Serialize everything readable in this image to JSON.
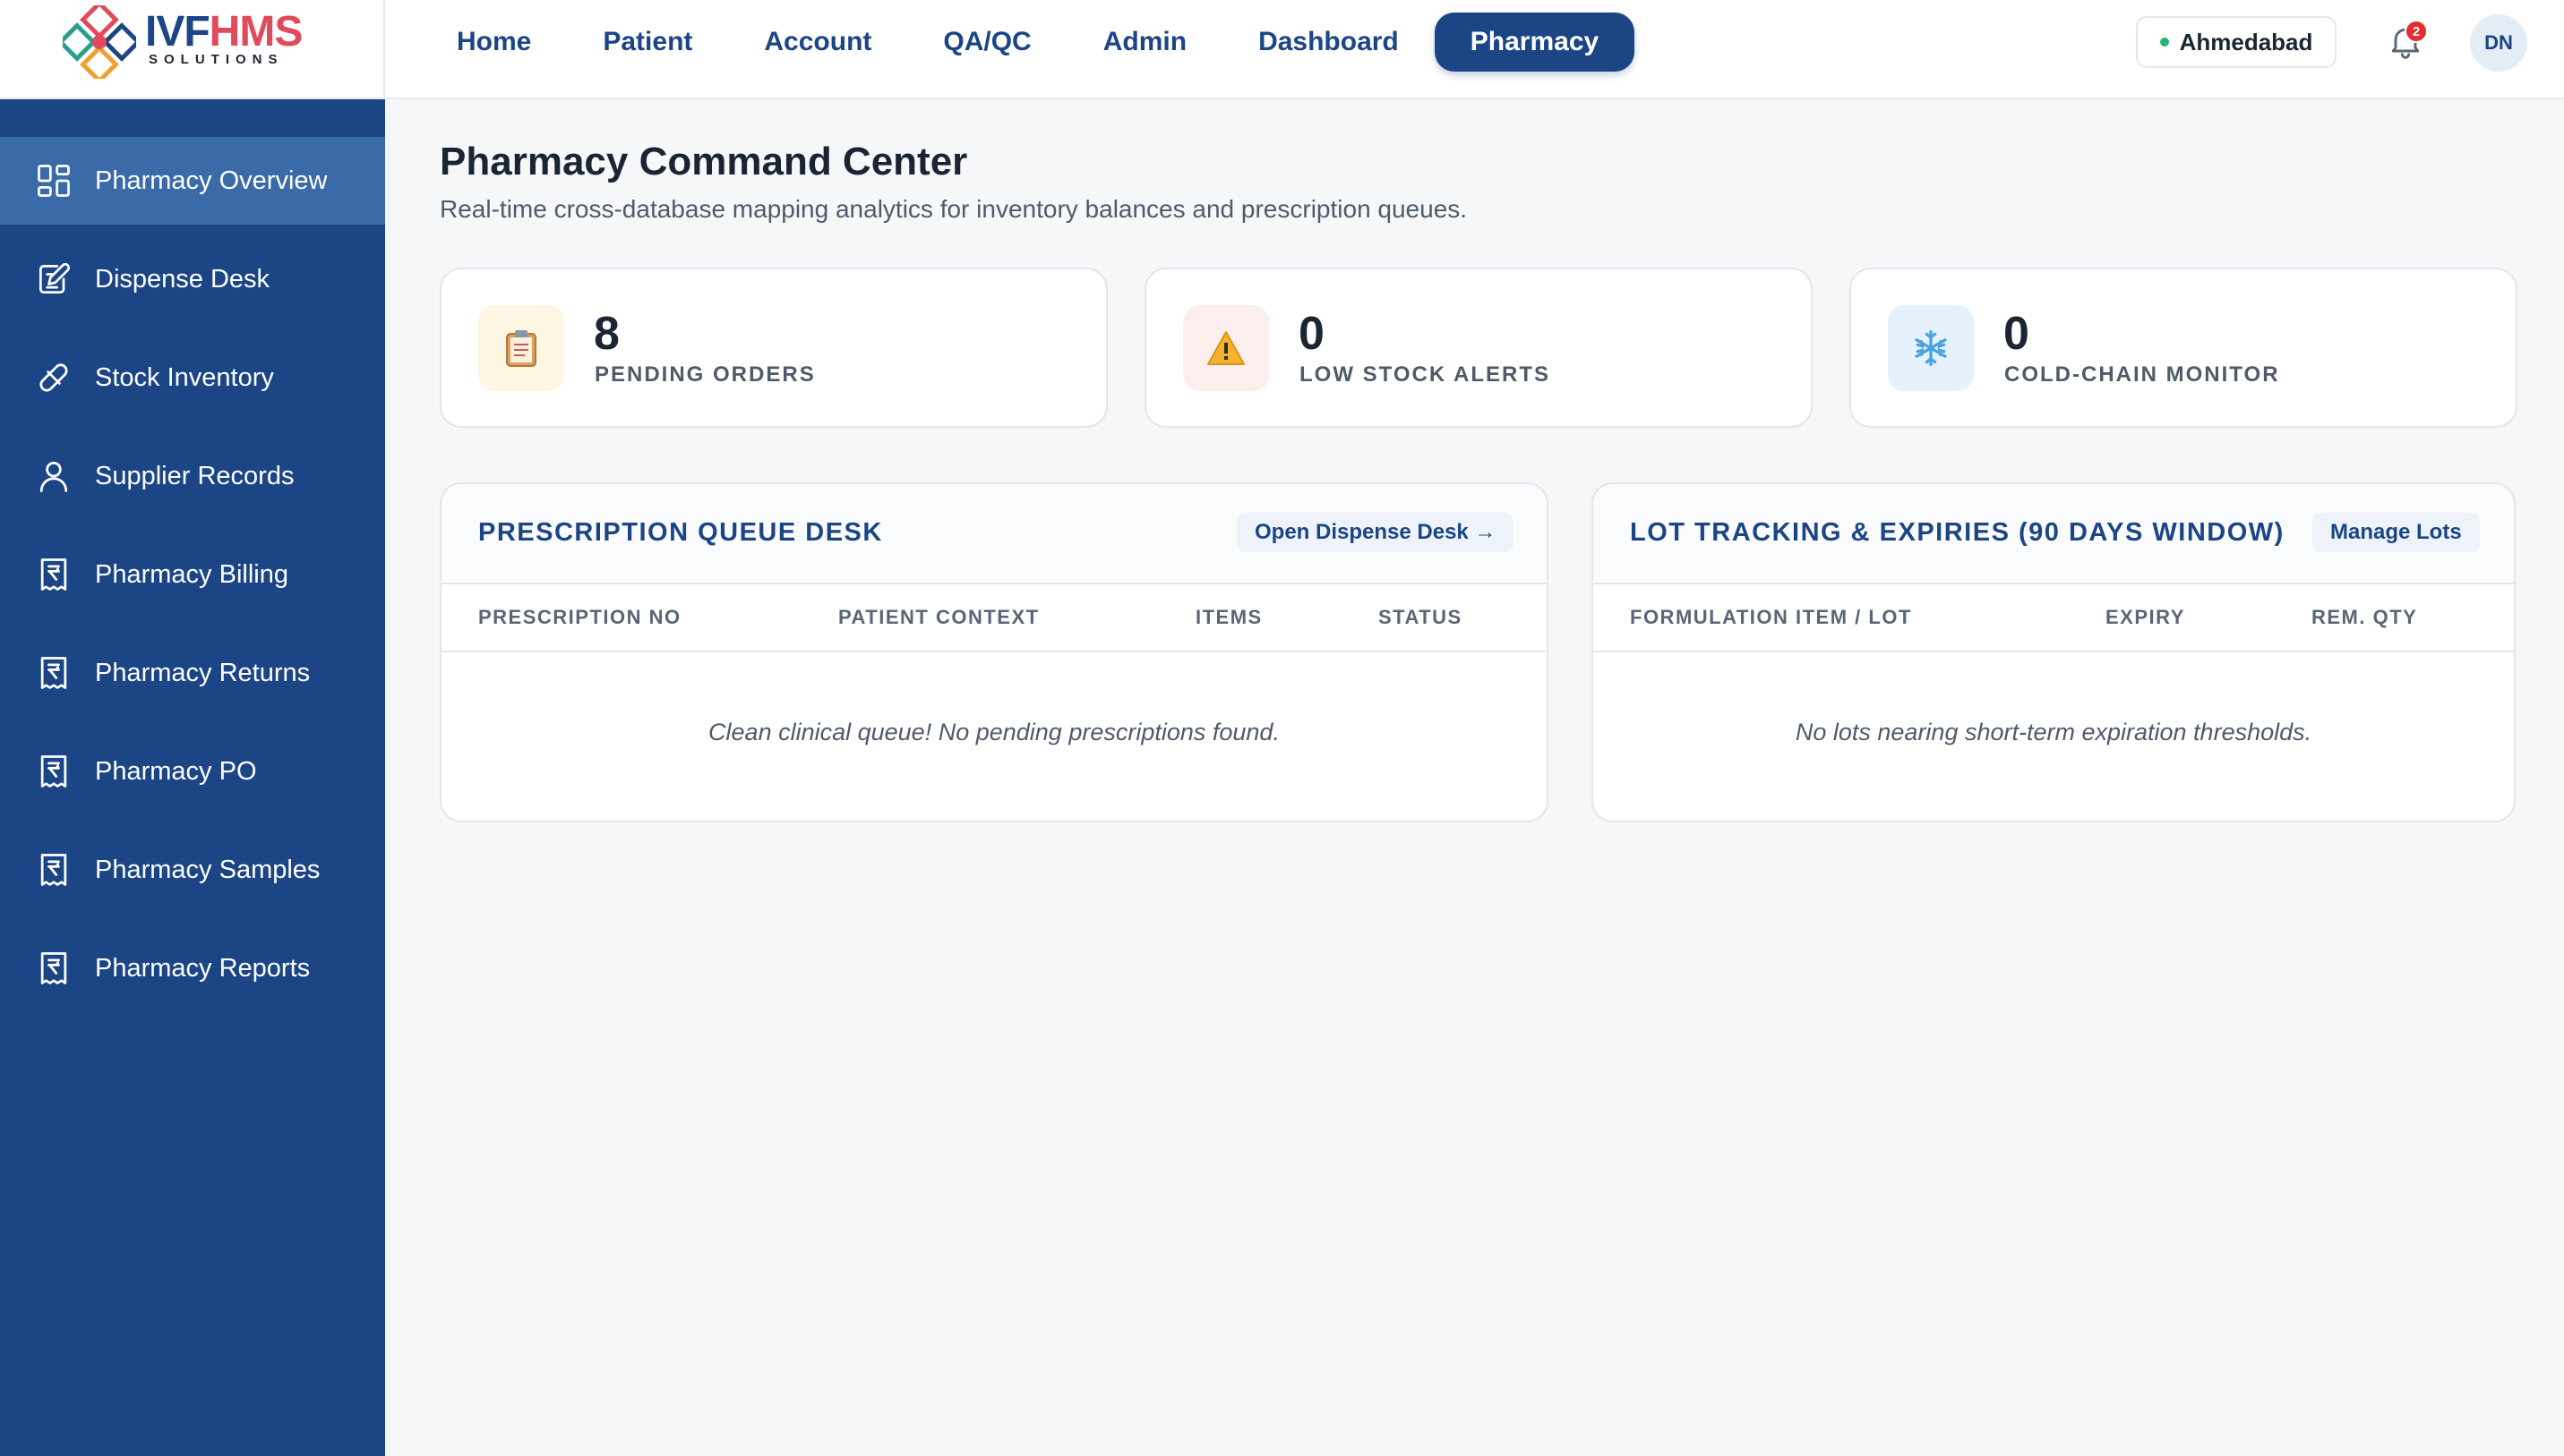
{
  "brand": {
    "name_part1": "IVF",
    "name_part2": "HMS",
    "subtitle": "SOLUTIONS"
  },
  "nav": {
    "items": [
      {
        "label": "Home"
      },
      {
        "label": "Patient"
      },
      {
        "label": "Account"
      },
      {
        "label": "QA/QC"
      },
      {
        "label": "Admin"
      },
      {
        "label": "Dashboard"
      },
      {
        "label": "Pharmacy",
        "active": true
      }
    ]
  },
  "header": {
    "branch": "Ahmedabad",
    "notification_count": "2",
    "avatar_initials": "DN"
  },
  "sidebar": {
    "items": [
      {
        "label": "Pharmacy Overview",
        "icon": "grid-icon",
        "active": true
      },
      {
        "label": "Dispense Desk",
        "icon": "edit-document-icon"
      },
      {
        "label": "Stock Inventory",
        "icon": "pill-icon"
      },
      {
        "label": "Supplier Records",
        "icon": "user-icon"
      },
      {
        "label": "Pharmacy Billing",
        "icon": "rupee-receipt-icon"
      },
      {
        "label": "Pharmacy Returns",
        "icon": "rupee-receipt-icon"
      },
      {
        "label": "Pharmacy PO",
        "icon": "rupee-receipt-icon"
      },
      {
        "label": "Pharmacy Samples",
        "icon": "rupee-receipt-icon"
      },
      {
        "label": "Pharmacy Reports",
        "icon": "rupee-receipt-icon"
      }
    ]
  },
  "main": {
    "title": "Pharmacy Command Center",
    "subtitle": "Real-time cross-database mapping analytics for inventory balances and prescription queues.",
    "stats": [
      {
        "value": "8",
        "label": "PENDING ORDERS",
        "icon": "clipboard-icon"
      },
      {
        "value": "0",
        "label": "LOW STOCK ALERTS",
        "icon": "warning-icon"
      },
      {
        "value": "0",
        "label": "COLD-CHAIN MONITOR",
        "icon": "snowflake-icon"
      }
    ],
    "prescription_panel": {
      "title": "PRESCRIPTION QUEUE DESK",
      "button": "Open Dispense Desk →",
      "columns": [
        "PRESCRIPTION NO",
        "PATIENT CONTEXT",
        "ITEMS",
        "STATUS"
      ],
      "empty_message": "Clean clinical queue! No pending prescriptions found."
    },
    "lot_panel": {
      "title": "LOT TRACKING & EXPIRIES (90 DAYS WINDOW)",
      "button": "Manage Lots",
      "columns": [
        "FORMULATION ITEM / LOT",
        "EXPIRY",
        "REM. QTY"
      ],
      "empty_message": "No lots nearing short-term expiration thresholds."
    }
  },
  "colors": {
    "primary": "#1b4585",
    "sidebar_active": "#3b6aa8",
    "brand_red": "#e04a5a",
    "status_green": "#22b573",
    "badge_red": "#e52d2d"
  }
}
